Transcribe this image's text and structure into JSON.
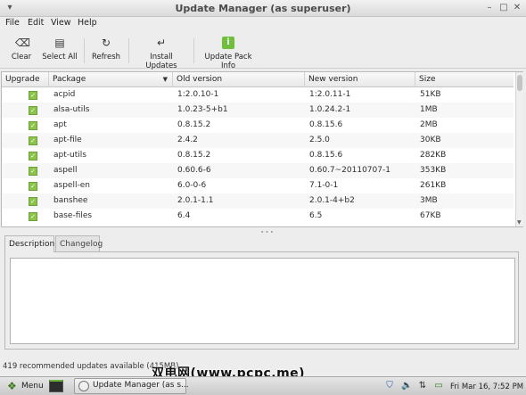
{
  "window": {
    "title": "Update Manager (as superuser)"
  },
  "menubar": {
    "items": [
      "File",
      "Edit",
      "View",
      "Help"
    ]
  },
  "toolbar": {
    "clear_label": "Clear",
    "select_all_label": "Select All",
    "refresh_label": "Refresh",
    "install_label": "Install Updates",
    "update_pack_label": "Update Pack Info"
  },
  "table": {
    "columns": [
      "Upgrade",
      "Package",
      "Old version",
      "New version",
      "Size"
    ],
    "rows": [
      {
        "package": "acpid",
        "old": "1:2.0.10-1",
        "new": "1:2.0.11-1",
        "size": "51KB"
      },
      {
        "package": "alsa-utils",
        "old": "1.0.23-5+b1",
        "new": "1.0.24.2-1",
        "size": "1MB"
      },
      {
        "package": "apt",
        "old": "0.8.15.2",
        "new": "0.8.15.6",
        "size": "2MB"
      },
      {
        "package": "apt-file",
        "old": "2.4.2",
        "new": "2.5.0",
        "size": "30KB"
      },
      {
        "package": "apt-utils",
        "old": "0.8.15.2",
        "new": "0.8.15.6",
        "size": "282KB"
      },
      {
        "package": "aspell",
        "old": "0.60.6-6",
        "new": "0.60.7~20110707-1",
        "size": "353KB"
      },
      {
        "package": "aspell-en",
        "old": "6.0-0-6",
        "new": "7.1-0-1",
        "size": "261KB"
      },
      {
        "package": "banshee",
        "old": "2.0.1-1.1",
        "new": "2.0.1-4+b2",
        "size": "3MB"
      },
      {
        "package": "base-files",
        "old": "6.4",
        "new": "6.5",
        "size": "67KB"
      }
    ]
  },
  "tabs": {
    "description": "Description",
    "changelog": "Changelog"
  },
  "status": {
    "text": "419 recommended updates available (415MB)"
  },
  "taskbar": {
    "menu_label": "Menu",
    "task_label": "Update Manager (as s...",
    "clock": "Fri Mar 16,  7:52 PM"
  },
  "watermark": {
    "text": "双电网(www.pcpc.me)"
  },
  "colors": {
    "checkbox_green": "#8cc44b",
    "update_pack_icon_green": "#6fbf3c"
  }
}
